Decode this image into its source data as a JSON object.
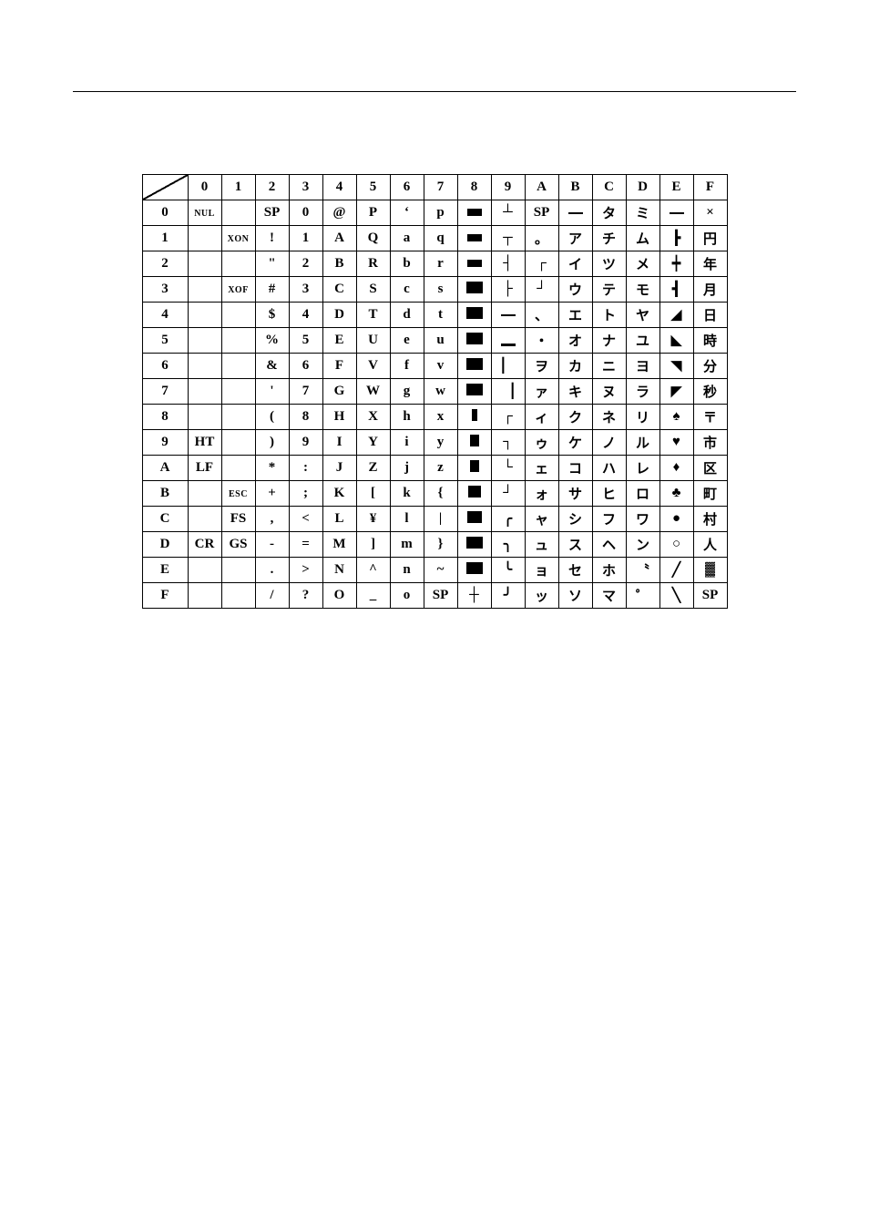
{
  "chart_data": {
    "type": "table",
    "description": "16x16 character code table. Columns are high-nibble 0-F, rows are low-nibble 0-F.",
    "col_headers": [
      "0",
      "1",
      "2",
      "3",
      "4",
      "5",
      "6",
      "7",
      "8",
      "9",
      "A",
      "B",
      "C",
      "D",
      "E",
      "F"
    ],
    "row_headers": [
      "0",
      "1",
      "2",
      "3",
      "4",
      "5",
      "6",
      "7",
      "8",
      "9",
      "A",
      "B",
      "C",
      "D",
      "E",
      "F"
    ],
    "rows": [
      {
        "hdr": "0",
        "cells": [
          "NUL",
          "",
          "SP",
          "0",
          "@",
          "P",
          "‘",
          "p",
          "▄",
          "┴",
          "SP",
          "—",
          "タ",
          "ミ",
          "—",
          "×"
        ]
      },
      {
        "hdr": "1",
        "cells": [
          "",
          "XON",
          "!",
          "1",
          "A",
          "Q",
          "a",
          "q",
          "▄",
          "┬",
          "。",
          "ア",
          "チ",
          "ム",
          "┣",
          "円"
        ]
      },
      {
        "hdr": "2",
        "cells": [
          "",
          "",
          "\"",
          "2",
          "B",
          "R",
          "b",
          "r",
          "▄",
          "┤",
          "┌",
          "イ",
          "ツ",
          "メ",
          "┿",
          "年"
        ]
      },
      {
        "hdr": "3",
        "cells": [
          "",
          "XOF",
          "#",
          "3",
          "C",
          "S",
          "c",
          "s",
          "█",
          "├",
          "┘",
          "ウ",
          "テ",
          "モ",
          "┫",
          "月"
        ]
      },
      {
        "hdr": "4",
        "cells": [
          "",
          "",
          "$",
          "4",
          "D",
          "T",
          "d",
          "t",
          "█",
          "─",
          "、",
          "エ",
          "ト",
          "ヤ",
          "◢",
          "日"
        ]
      },
      {
        "hdr": "5",
        "cells": [
          "",
          "",
          "%",
          "5",
          "E",
          "U",
          "e",
          "u",
          "█",
          "▁",
          "・",
          "オ",
          "ナ",
          "ユ",
          "◣",
          "時"
        ]
      },
      {
        "hdr": "6",
        "cells": [
          "",
          "",
          "&",
          "6",
          "F",
          "V",
          "f",
          "v",
          "█",
          "▏",
          "ヲ",
          "カ",
          "ニ",
          "ヨ",
          "◥",
          "分"
        ]
      },
      {
        "hdr": "7",
        "cells": [
          "",
          "",
          "'",
          "7",
          "G",
          "W",
          "g",
          "w",
          "█",
          "▕",
          "ァ",
          "キ",
          "ヌ",
          "ラ",
          "◤",
          "秒"
        ]
      },
      {
        "hdr": "8",
        "cells": [
          "",
          "",
          "(",
          "8",
          "H",
          "X",
          "h",
          "x",
          "▎",
          "┌",
          "ィ",
          "ク",
          "ネ",
          "リ",
          "♠",
          "〒"
        ]
      },
      {
        "hdr": "9",
        "cells": [
          "HT",
          "",
          ")",
          "9",
          "I",
          "Y",
          "i",
          "y",
          "▌",
          "┐",
          "ゥ",
          "ケ",
          "ノ",
          "ル",
          "♥",
          "市"
        ]
      },
      {
        "hdr": "A",
        "cells": [
          "LF",
          "",
          "*",
          ":",
          "J",
          "Z",
          "j",
          "z",
          "▌",
          "└",
          "ェ",
          "コ",
          "ハ",
          "レ",
          "♦",
          "区"
        ]
      },
      {
        "hdr": "B",
        "cells": [
          "",
          "ESC",
          "+",
          ";",
          "K",
          "[",
          "k",
          "{",
          "▊",
          "┘",
          "ォ",
          "サ",
          "ヒ",
          "ロ",
          "♣",
          "町"
        ]
      },
      {
        "hdr": "C",
        "cells": [
          "",
          "FS",
          ",",
          "<",
          "L",
          "¥",
          "l",
          "|",
          "▉",
          "╭",
          "ャ",
          "シ",
          "フ",
          "ワ",
          "●",
          "村"
        ]
      },
      {
        "hdr": "D",
        "cells": [
          "CR",
          "GS",
          "-",
          "=",
          "M",
          "]",
          "m",
          "}",
          "█",
          "╮",
          "ュ",
          "ス",
          "ヘ",
          "ン",
          "○",
          "人"
        ]
      },
      {
        "hdr": "E",
        "cells": [
          "",
          "",
          ".",
          ">",
          "N",
          "^",
          "n",
          "~",
          "█",
          "╰",
          "ョ",
          "セ",
          "ホ",
          "〝",
          "╱",
          "▓"
        ]
      },
      {
        "hdr": "F",
        "cells": [
          "",
          "",
          "/",
          "?",
          "O",
          "_",
          "o",
          "SP",
          "┼",
          "╯",
          "ッ",
          "ソ",
          "マ",
          "゜",
          "╲",
          "SP"
        ]
      }
    ]
  }
}
